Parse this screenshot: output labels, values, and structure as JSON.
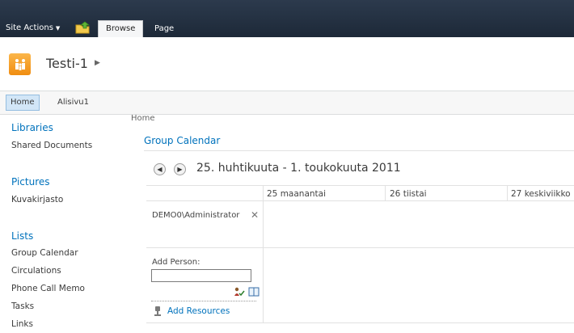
{
  "ribbon": {
    "site_actions": "Site Actions",
    "tabs": [
      "Browse",
      "Page"
    ]
  },
  "site": {
    "title": "Testi-1"
  },
  "topnav": {
    "items": [
      "Home",
      "Alisivu1"
    ]
  },
  "quicklaunch": {
    "libraries": {
      "heading": "Libraries",
      "items": [
        "Shared Documents"
      ]
    },
    "pictures": {
      "heading": "Pictures",
      "items": [
        "Kuvakirjasto"
      ]
    },
    "lists": {
      "heading": "Lists",
      "items": [
        "Group Calendar",
        "Circulations",
        "Phone Call Memo",
        "Tasks",
        "Links"
      ]
    }
  },
  "main": {
    "breadcrumb": "Home",
    "webpart_title": "Group Calendar",
    "date_range": "25. huhtikuuta - 1. toukokuuta 2011",
    "days": [
      "25 maanantai",
      "26 tiistai",
      "27 keskiviikko"
    ],
    "person": "DEMO0\\Administrator",
    "add_person_label": "Add Person:",
    "add_person_value": "",
    "add_resources": "Add Resources"
  },
  "colors": {
    "ribbon_bg": "#1d2938",
    "link": "#0072bc",
    "logo": "#f08d11"
  },
  "icons": [
    "up-folder-icon",
    "site-logo-icon",
    "prev-arrow-icon",
    "next-arrow-icon",
    "close-icon",
    "check-names-icon",
    "address-book-icon",
    "resource-icon"
  ]
}
